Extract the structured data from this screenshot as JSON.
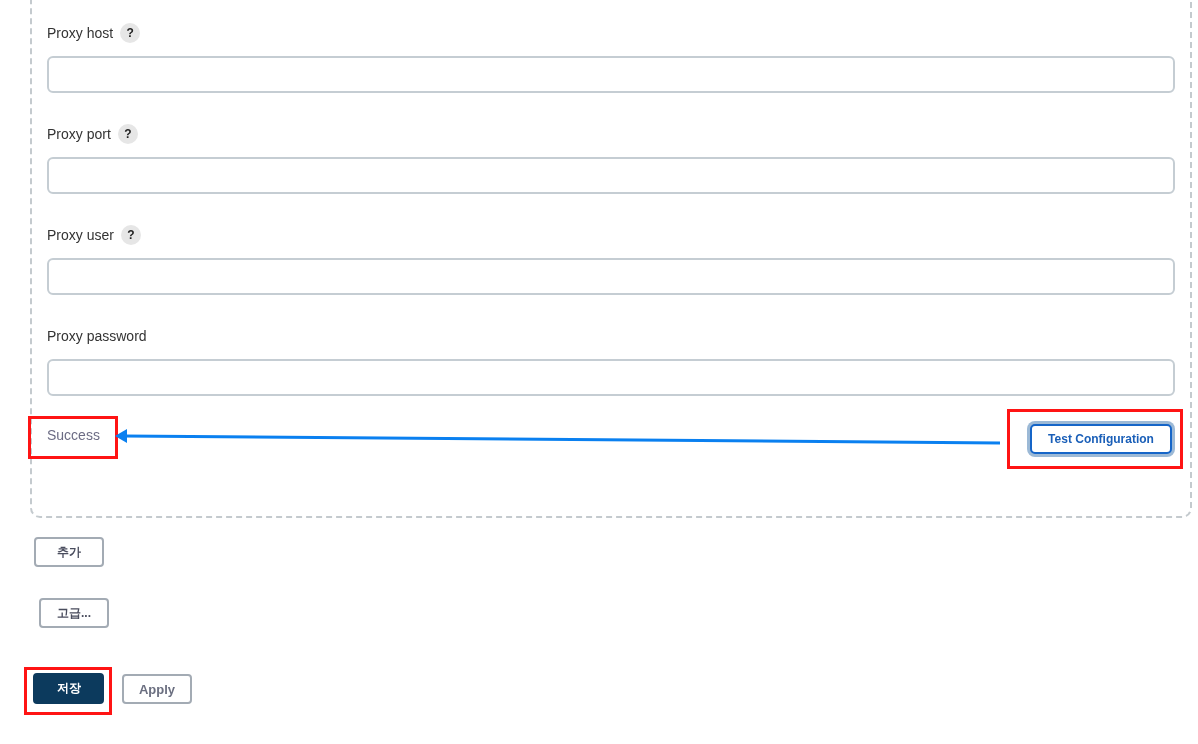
{
  "proxy_fields": [
    {
      "label": "Proxy host",
      "help": "?"
    },
    {
      "label": "Proxy port",
      "help": "?"
    },
    {
      "label": "Proxy user",
      "help": "?"
    },
    {
      "label": "Proxy password"
    }
  ],
  "status": {
    "text": "Success",
    "highlighted": true
  },
  "test_button": {
    "label": "Test Configuration",
    "focused": true,
    "highlighted": true
  },
  "add_button": {
    "label": "추가"
  },
  "advanced_button": {
    "label": "고급..."
  },
  "actions": [
    {
      "label": "저장",
      "kind": "primary",
      "highlighted": true
    },
    {
      "label": "Apply",
      "kind": "secondary",
      "highlighted": false
    }
  ]
}
